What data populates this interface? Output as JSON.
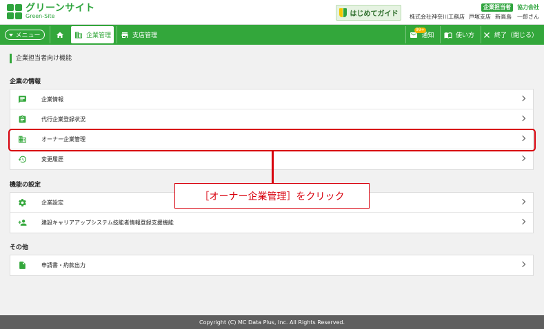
{
  "header": {
    "logo_title": "グリーンサイト",
    "logo_sub": "Green-Site",
    "guide_label": "はじめてガイド",
    "role_badge": "企業担当者",
    "partner_label": "協力会社",
    "company_name": "株式会社神奈川工務店",
    "branch_name": "戸塚支店",
    "person_name": "新高島　一郎さん"
  },
  "nav": {
    "menu_label": "メニュー",
    "company_mgmt": "企業管理",
    "branch_mgmt": "支店管理",
    "notice_badge": "99+",
    "notice_label": "通知",
    "howto_label": "使い方",
    "exit_label": "終了（閉じる）"
  },
  "page": {
    "section_title": "企業担当者向け機能"
  },
  "groups": [
    {
      "title": "企業の情報",
      "items": [
        {
          "label": "企業情報",
          "icon": "chat-icon"
        },
        {
          "label": "代行企業登録状況",
          "icon": "clipboard-icon"
        },
        {
          "label": "オーナー企業管理",
          "icon": "building-icon"
        },
        {
          "label": "変更履歴",
          "icon": "history-icon"
        }
      ]
    },
    {
      "title": "機能の設定",
      "items": [
        {
          "label": "企業設定",
          "icon": "gear-icon"
        },
        {
          "label": "建設キャリアアップシステム技能者情報登録支援機能",
          "icon": "add-person-icon"
        }
      ]
    },
    {
      "title": "その他",
      "items": [
        {
          "label": "申請書・約款出力",
          "icon": "document-icon"
        }
      ]
    }
  ],
  "callout": {
    "text": "［オーナー企業管理］をクリック"
  },
  "footer": {
    "copyright": "Copyright (C) MC Data Plus, Inc. All Rights Reserved."
  },
  "colors": {
    "brand_green": "#33a73b",
    "highlight_red": "#d8000c"
  }
}
